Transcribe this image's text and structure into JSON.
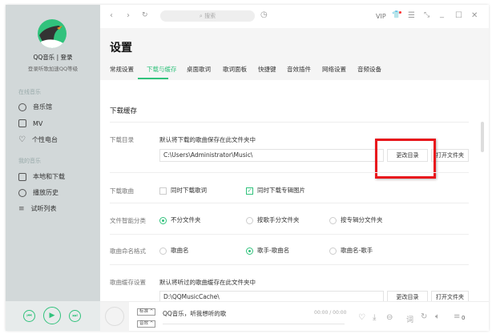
{
  "sidebar": {
    "user": "QQ音乐 | 登录",
    "subtitle": "登录听歌加速QQ等级",
    "section_online": "在线音乐",
    "online_items": [
      {
        "label": "音乐馆",
        "icon": "music-hall-icon"
      },
      {
        "label": "MV",
        "icon": "mv-icon"
      },
      {
        "label": "个性电台",
        "icon": "radio-heart-icon"
      }
    ],
    "section_mine": "我的音乐",
    "mine_items": [
      {
        "label": "本地和下载",
        "icon": "monitor-icon"
      },
      {
        "label": "播放历史",
        "icon": "clock-icon"
      },
      {
        "label": "试听列表",
        "icon": "playlist-icon"
      }
    ]
  },
  "topbar": {
    "search_placeholder": "搜索",
    "vip": "VIP"
  },
  "settings": {
    "title": "设置",
    "tabs": [
      "常规设置",
      "下载与缓存",
      "桌面歌词",
      "歌词面板",
      "快捷键",
      "音效插件",
      "网络设置",
      "音频设备"
    ],
    "active_tab": 1,
    "section": "下载缓存",
    "download_dir": {
      "label": "下载目录",
      "desc": "默认将下载的歌曲保存在此文件夹中",
      "path": "C:\\Users\\Administrator\\Music\\",
      "change": "更改目录",
      "open": "打开文件夹"
    },
    "download_song": {
      "label": "下载歌曲",
      "opt1": "同时下载歌词",
      "opt1_checked": false,
      "opt2": "同时下载专辑图片",
      "opt2_checked": true
    },
    "classify": {
      "label": "文件智能分类",
      "options": [
        "不分文件夹",
        "按歌手分文件夹",
        "按专辑分文件夹"
      ],
      "selected": 0
    },
    "naming": {
      "label": "歌曲命名格式",
      "options": [
        "歌曲名",
        "歌手-歌曲名",
        "歌曲名-歌手"
      ],
      "selected": 1
    },
    "cache": {
      "label": "歌曲缓存设置",
      "desc": "默认将听过的歌曲缓存在此文件夹中",
      "path": "D:\\QQMusicCache\\",
      "change": "更改目录",
      "open": "打开文件夹"
    }
  },
  "player": {
    "quality": "标准 ^",
    "effect": "音效 ^",
    "song": "QQ音乐，听我想听的歌",
    "time": "00:00 / 00:00",
    "lyric": "词",
    "queue_count": "0"
  },
  "colors": {
    "accent": "#31c27c",
    "highlight": "#e8161c"
  }
}
